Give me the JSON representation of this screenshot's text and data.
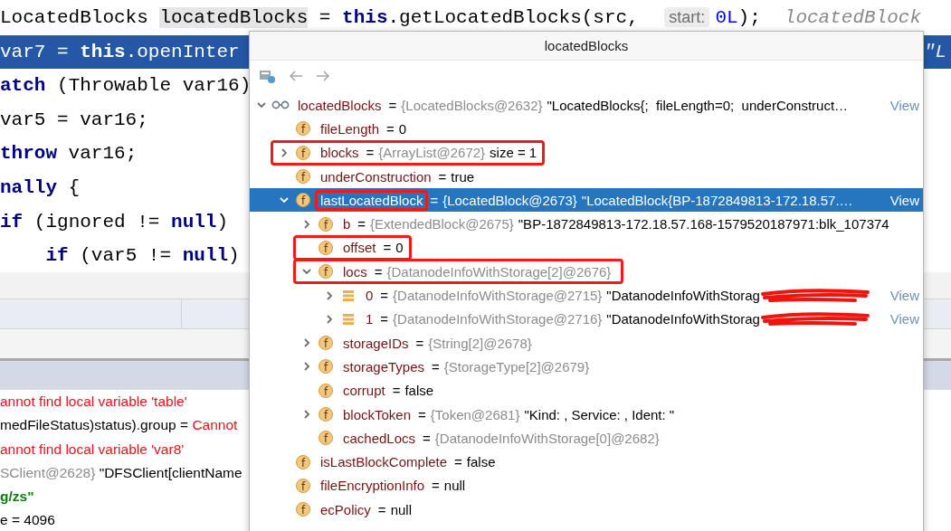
{
  "code_lines": [
    {
      "current": false,
      "segments": [
        {
          "kind": "code",
          "text": "LocatedBlocks "
        },
        {
          "kind": "usage",
          "text": "locatedBlocks"
        },
        {
          "kind": "code",
          "text": " = **this**.getLocatedBlocks(src, "
        },
        {
          "kind": "hint",
          "text": "start:"
        },
        {
          "kind": "number",
          "text": "0L"
        },
        {
          "kind": "code",
          "text": ");"
        },
        {
          "kind": "comment",
          "text": "locatedBlock"
        }
      ]
    },
    {
      "current": true,
      "segments": [
        {
          "kind": "code",
          "text": "var7 = **this**.openInter"
        }
      ],
      "tail": "\"L"
    },
    {
      "current": false,
      "segments": [
        {
          "kind": "code",
          "text": "**atch** (Throwable var16)"
        }
      ]
    },
    {
      "current": false,
      "segments": [
        {
          "kind": "code",
          "text": "var5 = var16;"
        }
      ]
    },
    {
      "current": false,
      "segments": [
        {
          "kind": "code",
          "text": "**throw** var16;"
        }
      ]
    },
    {
      "current": false,
      "segments": [
        {
          "kind": "code",
          "text": "**nally** {"
        }
      ]
    },
    {
      "current": false,
      "segments": [
        {
          "kind": "code",
          "text": "**if** (ignored != **null**)"
        }
      ]
    },
    {
      "current": false,
      "segments": [
        {
          "kind": "code",
          "text": "    **if** (var5 != **null**)"
        }
      ]
    }
  ],
  "variables": [
    {
      "segments": [
        {
          "kind": "error",
          "text": "annot find local variable 'table'"
        }
      ]
    },
    {
      "segments": [
        {
          "kind": "plain",
          "text": "medFileStatus)status).group = "
        },
        {
          "kind": "error",
          "text": "Cannot"
        }
      ]
    },
    {
      "segments": [
        {
          "kind": "error",
          "text": "annot find local variable 'var8'"
        }
      ]
    },
    {
      "segments": [
        {
          "kind": "type",
          "text": "SClient@2628}"
        },
        {
          "kind": "plain",
          "text": " \"DFSClient[clientName"
        }
      ]
    },
    {
      "segments": [
        {
          "kind": "string",
          "text": "g/zs\""
        }
      ]
    },
    {
      "segments": [
        {
          "kind": "plain",
          "text": "e = 4096"
        }
      ]
    }
  ],
  "popup": {
    "title": "locatedBlocks",
    "toolbar": [
      {
        "kind": "watch"
      },
      {
        "kind": "back",
        "disabled": true
      },
      {
        "kind": "forward",
        "disabled": true
      }
    ],
    "tree": [
      {
        "name": "locatedBlocks",
        "op": "=",
        "type": "{LocatedBlocks@2632}",
        "value": "\"LocatedBlocks{;  fileLength=0;  underConstruct…",
        "link": "View",
        "kind": "watch",
        "expanded": true,
        "selected": false,
        "children": [
          {
            "name": "fileLength",
            "op": "=",
            "value": "0",
            "kind": "field",
            "badge": "f",
            "selected": false
          },
          {
            "name": "blocks",
            "op": "=",
            "type": "{ArrayList@2672}",
            "value": "size = 1",
            "kind": "field",
            "badge": "f",
            "expanded": false,
            "boxed": true,
            "selected": false
          },
          {
            "name": "underConstruction",
            "op": "=",
            "value": "true",
            "kind": "field",
            "badge": "f",
            "selected": false
          },
          {
            "name": "lastLocatedBlock",
            "op": "=",
            "type": "{LocatedBlock@2673}",
            "value": "\"LocatedBlock{BP-1872849813-172.18.57.…",
            "link": "View",
            "kind": "field",
            "badge": "f",
            "expanded": true,
            "name_boxed": true,
            "selected": true,
            "children": [
              {
                "name": "b",
                "op": "=",
                "type": "{ExtendedBlock@2675}",
                "value": "\"BP-1872849813-172.18.57.168-1579520187971:blk_107374",
                "kind": "field",
                "badge": "f",
                "expanded": false,
                "selected": false
              },
              {
                "name": "offset",
                "op": "=",
                "value": "0",
                "kind": "field",
                "badge": "f",
                "boxed": true,
                "selected": false
              },
              {
                "name": "locs",
                "op": "=",
                "type": "{DatanodeInfoWithStorage[2]@2676}",
                "kind": "field",
                "badge": "f",
                "expanded": true,
                "boxed": true,
                "selected": false,
                "children": [
                  {
                    "name": "0",
                    "op": "=",
                    "type": "{DatanodeInfoWithStorage@2715}",
                    "value": "\"DatanodeInfoWithStorag",
                    "link": "View",
                    "kind": "element",
                    "expanded": false,
                    "redacted": true,
                    "selected": false
                  },
                  {
                    "name": "1",
                    "op": "=",
                    "type": "{DatanodeInfoWithStorage@2716}",
                    "value": "\"DatanodeInfoWithStorag",
                    "link": "View",
                    "kind": "element",
                    "expanded": false,
                    "redacted": true,
                    "selected": false
                  }
                ]
              },
              {
                "name": "storageIDs",
                "op": "=",
                "type": "{String[2]@2678}",
                "kind": "field",
                "badge": "f",
                "expanded": false,
                "selected": false
              },
              {
                "name": "storageTypes",
                "op": "=",
                "type": "{StorageType[2]@2679}",
                "kind": "field",
                "badge": "f",
                "expanded": false,
                "selected": false
              },
              {
                "name": "corrupt",
                "op": "=",
                "value": "false",
                "kind": "field",
                "badge": "f",
                "selected": false
              },
              {
                "name": "blockToken",
                "op": "=",
                "type": "{Token@2681}",
                "value": "\"Kind: , Service: , Ident: \"",
                "kind": "field",
                "badge": "f",
                "expanded": false,
                "selected": false
              },
              {
                "name": "cachedLocs",
                "op": "=",
                "type": "{DatanodeInfoWithStorage[0]@2682}",
                "kind": "field",
                "badge": "f",
                "selected": false
              }
            ]
          },
          {
            "name": "isLastBlockComplete",
            "op": "=",
            "value": "false",
            "kind": "field",
            "badge": "f",
            "selected": false
          },
          {
            "name": "fileEncryptionInfo",
            "op": "=",
            "value": "null",
            "kind": "field",
            "badge": "f",
            "selected": false
          },
          {
            "name": "ecPolicy",
            "op": "=",
            "value": "null",
            "kind": "field",
            "badge": "f",
            "selected": false
          }
        ]
      }
    ]
  }
}
